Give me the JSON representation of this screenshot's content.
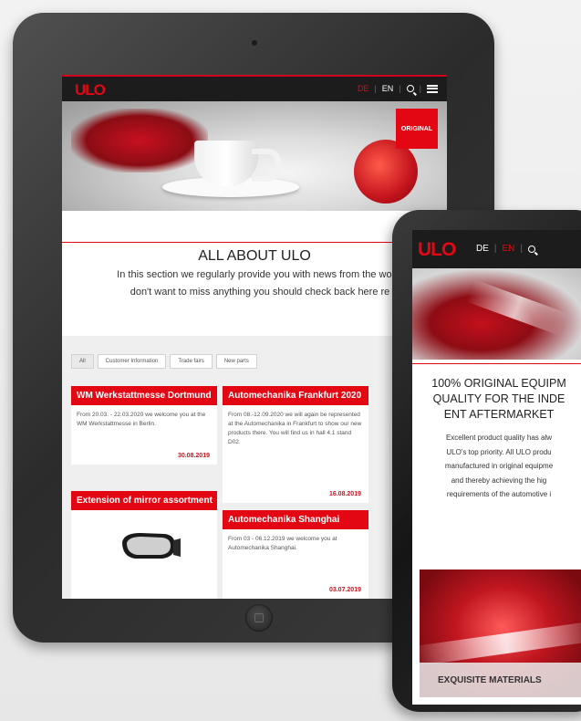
{
  "brand": {
    "logo": "ULO",
    "accent": "#e30613"
  },
  "tablet": {
    "nav": {
      "lang_de": "DE",
      "lang_en": "EN",
      "sep": "|"
    },
    "hero": {
      "badge": "ORIGINAL"
    },
    "section_title": "ALL ABOUT ULO",
    "intro_line1": "In this section we regularly provide you with news from the world",
    "intro_line2": "don't want to miss anything you should check back here re",
    "filters": [
      "All",
      "Customer Information",
      "Trade fairs",
      "New parts"
    ],
    "cards": [
      {
        "title": "WM Werkstattmesse Dortmund",
        "text": "From 20.03. - 22.03.2020 we welcome you at the WM Werkstattmesse in Berlin.",
        "date": "30.08.2019"
      },
      {
        "title": "Automechanika Frankfurt 2020",
        "text": "From 08.-12.09.2020 we will again be represented at the Automechanika in Frankfurt to show our new products there. You will find us in hall 4.1 stand D02.",
        "date": "16.08.2019"
      },
      {
        "title": "Extension of mirror assortment",
        "text": "",
        "date": ""
      },
      {
        "title": "Automechanika Shanghai",
        "text": "From 03 - 06.12.2019 we welcome you at Automechanika Shanghai.",
        "date": "03.07.2019"
      }
    ]
  },
  "phone": {
    "nav": {
      "lang_de": "DE",
      "lang_en": "EN",
      "sep": "|"
    },
    "heading_line1": "100% ORIGINAL EQUIPM",
    "heading_line2": "QUALITY FOR THE INDE",
    "heading_line3": "ENT AFTERMARKET",
    "text_line1": "Excellent product quality has alw",
    "text_line2": "ULO's top priority. All ULO produ",
    "text_line3": "manufactured in original equipme",
    "text_line4": "and thereby achieving the hig",
    "text_line5": "requirements of the automotive i",
    "feature_label": "EXQUISITE MATERIALS"
  }
}
